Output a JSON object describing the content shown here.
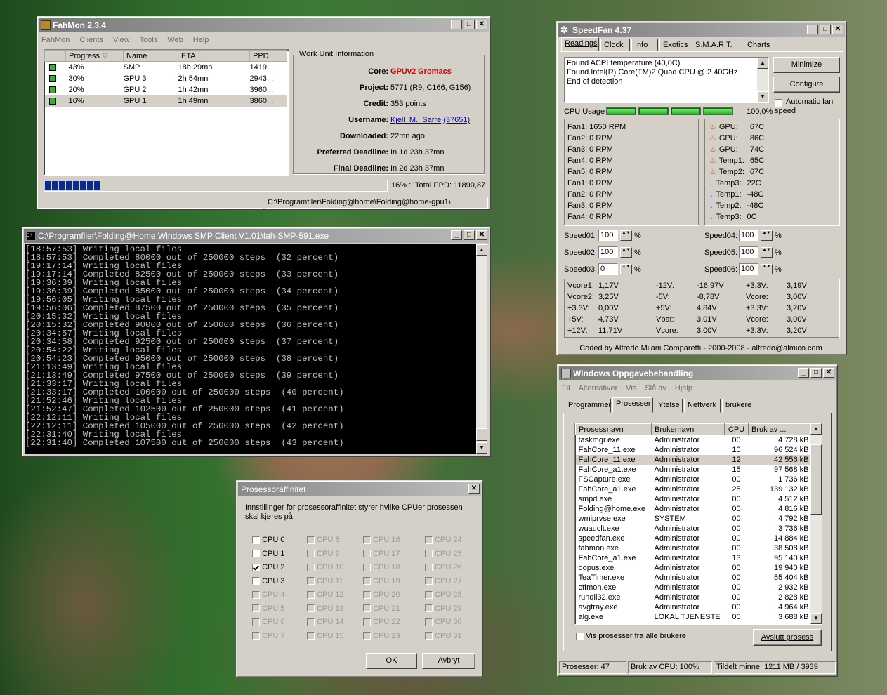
{
  "fahmon": {
    "title": "FahMon 2.3.4",
    "menu": [
      "FahMon",
      "Clients",
      "View",
      "Tools",
      "Web",
      "Help"
    ],
    "columns": [
      "Progress",
      "Name",
      "ETA",
      "PPD"
    ],
    "rows": [
      {
        "progress": "43%",
        "name": "SMP",
        "eta": "18h 29mn",
        "ppd": "1419..."
      },
      {
        "progress": "30%",
        "name": "GPU 3",
        "eta": "2h 54mn",
        "ppd": "2943..."
      },
      {
        "progress": "20%",
        "name": "GPU 2",
        "eta": "1h 42mn",
        "ppd": "3960..."
      },
      {
        "progress": "16%",
        "name": "GPU 1",
        "eta": "1h 49mn",
        "ppd": "3860..."
      }
    ],
    "wu_title": "Work Unit Information",
    "wu_labels": {
      "core": "Core:",
      "project": "Project:",
      "credit": "Credit:",
      "username": "Username:",
      "downloaded": "Downloaded:",
      "preferred": "Preferred Deadline:",
      "final": "Final Deadline:"
    },
    "wu": {
      "core": "GPUv2 Gromacs",
      "project": "5771 (R9, C166, G156)",
      "credit": "353 points",
      "user": "Kjell_M._Sarre",
      "user_id": "(37651)",
      "downloaded": "22mn ago",
      "preferred": "In 1d 23h 37mn",
      "final": "In 2d 23h 37mn"
    },
    "progress_fraction": 0.16,
    "total": "16% :: Total PPD: 11890,87",
    "status_path": "C:\\Programfiler\\Folding@home\\Folding@home-gpu1\\"
  },
  "console": {
    "title": "C:\\Programfiler\\Folding@Home Windows SMP Client V1.01\\fah-SMP-591.exe",
    "lines": [
      "[18:57:53] Writing local files",
      "[18:57:53] Completed 80000 out of 250000 steps  (32 percent)",
      "[19:17:14] Writing local files",
      "[19:17:14] Completed 82500 out of 250000 steps  (33 percent)",
      "[19:36:39] Writing local files",
      "[19:36:39] Completed 85000 out of 250000 steps  (34 percent)",
      "[19:56:05] Writing local files",
      "[19:56:06] Completed 87500 out of 250000 steps  (35 percent)",
      "[20:15:32] Writing local files",
      "[20:15:32] Completed 90000 out of 250000 steps  (36 percent)",
      "[20:34:57] Writing local files",
      "[20:34:58] Completed 92500 out of 250000 steps  (37 percent)",
      "[20:54:22] Writing local files",
      "[20:54:23] Completed 95000 out of 250000 steps  (38 percent)",
      "[21:13:49] Writing local files",
      "[21:13:49] Completed 97500 out of 250000 steps  (39 percent)",
      "[21:33:17] Writing local files",
      "[21:33:17] Completed 100000 out of 250000 steps  (40 percent)",
      "[21:52:46] Writing local files",
      "[21:52:47] Completed 102500 out of 250000 steps  (41 percent)",
      "[22:12:11] Writing local files",
      "[22:12:11] Completed 105000 out of 250000 steps  (42 percent)",
      "[22:31:40] Writing local files",
      "[22:31:40] Completed 107500 out of 250000 steps  (43 percent)"
    ]
  },
  "affinity": {
    "title": "Prosessoraffinitet",
    "desc": "Innstillinger for prosessoraffinitet styrer hvilke CPUer prosessen skal kjøres på.",
    "cpus": [
      "CPU 0",
      "CPU 1",
      "CPU 2",
      "CPU 3",
      "CPU 4",
      "CPU 5",
      "CPU 6",
      "CPU 7",
      "CPU 8",
      "CPU 9",
      "CPU 10",
      "CPU 11",
      "CPU 12",
      "CPU 13",
      "CPU 14",
      "CPU 15",
      "CPU 16",
      "CPU 17",
      "CPU 18",
      "CPU 19",
      "CPU 20",
      "CPU 21",
      "CPU 22",
      "CPU 23",
      "CPU 24",
      "CPU 25",
      "CPU 26",
      "CPU 27",
      "CPU 28",
      "CPU 29",
      "CPU 30",
      "CPU 31"
    ],
    "checked_cpu": "CPU 2",
    "enabled_count": 4,
    "ok": "OK",
    "cancel": "Avbryt"
  },
  "speedfan": {
    "title": "SpeedFan 4.37",
    "tabs": [
      "Readings",
      "Clock",
      "Info",
      "Exotics",
      "S.M.A.R.T.",
      "Charts"
    ],
    "log": [
      "Found ACPI temperature (40,0C)",
      "Found Intel(R) Core(TM)2 Quad CPU @ 2.40GHz",
      "End of detection"
    ],
    "minimize": "Minimize",
    "configure": "Configure",
    "auto_fan": "Automatic fan speed",
    "cpu_usage_label": "CPU Usage",
    "cpu_usage": "100,0%",
    "fans": [
      "Fan1: 1650 RPM",
      "Fan2: 0 RPM",
      "Fan3: 0 RPM",
      "Fan4: 0 RPM",
      "Fan5: 0 RPM",
      "Fan1: 0 RPM",
      "Fan2: 0 RPM",
      "Fan3: 0 RPM",
      "Fan4: 0 RPM"
    ],
    "temps": [
      {
        "label": "GPU:",
        "value": "67C",
        "icon": "flame"
      },
      {
        "label": "GPU:",
        "value": "86C",
        "icon": "flame"
      },
      {
        "label": "GPU:",
        "value": "74C",
        "icon": "flame"
      },
      {
        "label": "Temp1:",
        "value": "65C",
        "icon": "flame"
      },
      {
        "label": "Temp2:",
        "value": "67C",
        "icon": "flame"
      },
      {
        "label": "Temp3:",
        "value": "22C",
        "icon": "arrow-down"
      },
      {
        "label": "Temp1:",
        "value": "-48C",
        "icon": "arrow-down"
      },
      {
        "label": "Temp2:",
        "value": "-48C",
        "icon": "arrow-down"
      },
      {
        "label": "Temp3:",
        "value": "0C",
        "icon": "arrow-down"
      }
    ],
    "speeds": [
      {
        "label": "Speed01:",
        "value": "100"
      },
      {
        "label": "Speed02:",
        "value": "100"
      },
      {
        "label": "Speed03:",
        "value": "0"
      },
      {
        "label": "Speed04:",
        "value": "100"
      },
      {
        "label": "Speed05:",
        "value": "100"
      },
      {
        "label": "Speed06:",
        "value": "100"
      }
    ],
    "volts": [
      [
        [
          "Vcore1:",
          "1,17V"
        ],
        [
          "Vcore2:",
          "3,25V"
        ],
        [
          "+3.3V:",
          "0,00V"
        ],
        [
          "+5V:",
          "4,73V"
        ],
        [
          "+12V:",
          "11,71V"
        ]
      ],
      [
        [
          "-12V:",
          "-16,97V"
        ],
        [
          "-5V:",
          "-8,78V"
        ],
        [
          "+5V:",
          "4,84V"
        ],
        [
          "Vbat:",
          "3,01V"
        ],
        [
          "Vcore:",
          "3,00V"
        ]
      ],
      [
        [
          "+3.3V:",
          "3,19V"
        ],
        [
          "Vcore:",
          "3,00V"
        ],
        [
          "+3.3V:",
          "3,20V"
        ],
        [
          "Vcore:",
          "3,00V"
        ],
        [
          "+3.3V:",
          "3,20V"
        ]
      ]
    ],
    "footer": "Coded by Alfredo Milani Comparetti - 2000-2008 - alfredo@almico.com"
  },
  "taskmgr": {
    "title": "Windows Oppgavebehandling",
    "menu": [
      "Fil",
      "Alternativer",
      "Vis",
      "Slå av",
      "Hjelp"
    ],
    "tabs": [
      "Programmer",
      "Prosesser",
      "Ytelse",
      "Nettverk",
      "brukere"
    ],
    "columns": [
      "Prosessnavn",
      "Brukernavn",
      "CPU",
      "Bruk av ..."
    ],
    "rows": [
      [
        "taskmgr.exe",
        "Administrator",
        "00",
        "4 728 kB"
      ],
      [
        "FahCore_11.exe",
        "Administrator",
        "10",
        "96 524 kB"
      ],
      [
        "FahCore_11.exe",
        "Administrator",
        "12",
        "42 556 kB"
      ],
      [
        "FahCore_a1.exe",
        "Administrator",
        "15",
        "97 568 kB"
      ],
      [
        "FSCapture.exe",
        "Administrator",
        "00",
        "1 736 kB"
      ],
      [
        "FahCore_a1.exe",
        "Administrator",
        "25",
        "139 132 kB"
      ],
      [
        "smpd.exe",
        "Administrator",
        "00",
        "4 512 kB"
      ],
      [
        "Folding@home.exe",
        "Administrator",
        "00",
        "4 816 kB"
      ],
      [
        "wmiprvse.exe",
        "SYSTEM",
        "00",
        "4 792 kB"
      ],
      [
        "wuauclt.exe",
        "Administrator",
        "00",
        "3 736 kB"
      ],
      [
        "speedfan.exe",
        "Administrator",
        "00",
        "14 884 kB"
      ],
      [
        "fahmon.exe",
        "Administrator",
        "00",
        "38 508 kB"
      ],
      [
        "FahCore_a1.exe",
        "Administrator",
        "13",
        "95 140 kB"
      ],
      [
        "dopus.exe",
        "Administrator",
        "00",
        "19 940 kB"
      ],
      [
        "TeaTimer.exe",
        "Administrator",
        "00",
        "55 404 kB"
      ],
      [
        "ctfmon.exe",
        "Administrator",
        "00",
        "2 932 kB"
      ],
      [
        "rundll32.exe",
        "Administrator",
        "00",
        "2 828 kB"
      ],
      [
        "avgtray.exe",
        "Administrator",
        "00",
        "4 964 kB"
      ],
      [
        "alg.exe",
        "LOKAL TJENESTE",
        "00",
        "3 688 kB"
      ]
    ],
    "show_all": "Vis prosesser fra alle brukere",
    "end_process": "Avslutt prosess",
    "status": [
      "Prosesser: 47",
      "Bruk av CPU: 100%",
      "Tildelt minne: 1211 MB / 3939"
    ]
  }
}
